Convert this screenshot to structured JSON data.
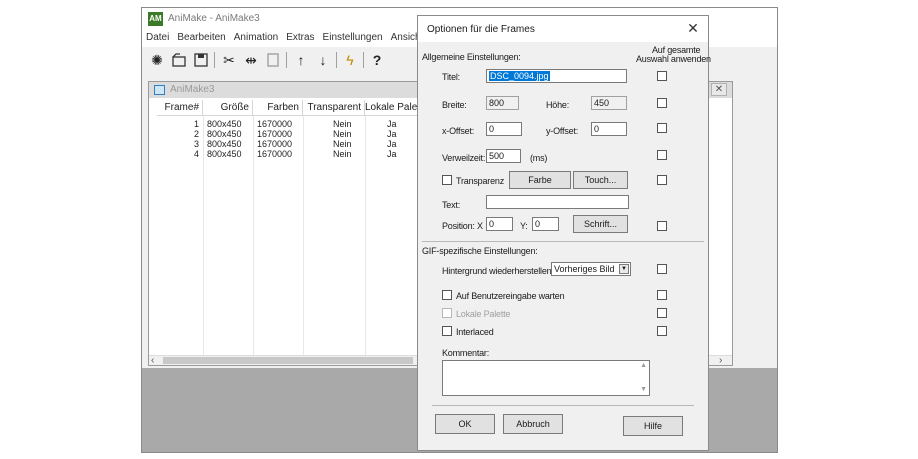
{
  "app": {
    "title": "AniMake - AniMake3",
    "logo": "AM",
    "menu": [
      "Datei",
      "Bearbeiten",
      "Animation",
      "Extras",
      "Einstellungen",
      "Ansicht"
    ],
    "toolbar_icons": [
      "sparkle-icon",
      "open-icon",
      "save-icon",
      "cut-icon",
      "move-icon",
      "paste-icon",
      "arrow-up-icon",
      "arrow-down-icon",
      "lightning-icon",
      "help-icon"
    ]
  },
  "child": {
    "title": "AniMake3",
    "close": "✕",
    "columns": [
      "Frame#",
      "Größe",
      "Farben",
      "Transparent",
      "Lokale Pale..."
    ],
    "rows": [
      [
        "1",
        "800x450",
        "1670000",
        "Nein",
        "Ja"
      ],
      [
        "2",
        "800x450",
        "1670000",
        "Nein",
        "Ja"
      ],
      [
        "3",
        "800x450",
        "1670000",
        "Nein",
        "Ja"
      ],
      [
        "4",
        "800x450",
        "1670000",
        "Nein",
        "Ja"
      ]
    ],
    "scroll_left": "‹",
    "scroll_right": "›"
  },
  "dialog": {
    "title": "Optionen für die Frames",
    "close": "✕",
    "general_header": "Allgemeine Einstellungen:",
    "apply_all_header_1": "Auf gesamte",
    "apply_all_header_2": "Auswahl anwenden",
    "title_label": "Titel:",
    "title_value": "DSC_0094.jpg",
    "width_label": "Breite:",
    "width_value": "800",
    "height_label": "Höhe:",
    "height_value": "450",
    "xoffset_label": "x-Offset:",
    "xoffset_value": "0",
    "yoffset_label": "y-Offset:",
    "yoffset_value": "0",
    "delay_label": "Verweilzeit:",
    "delay_value": "500",
    "delay_unit": "(ms)",
    "transparency_label": "Transparenz",
    "color_button": "Farbe",
    "touch_button": "Touch...",
    "text_label": "Text:",
    "text_value": "",
    "position_x_label": "Position: X",
    "position_x_value": "0",
    "position_y_label": "Y:",
    "position_y_value": "0",
    "font_button": "Schrift...",
    "gif_header": "GIF-spezifische Einstellungen:",
    "bg_restore_label": "Hintergrund wiederherstellen:",
    "bg_restore_value": "Vorheriges Bild",
    "wait_input_label": "Auf Benutzereingabe warten",
    "local_palette_label": "Lokale Palette",
    "interlaced_label": "Interlaced",
    "comment_label": "Kommentar:",
    "comment_value": "",
    "ok_button": "OK",
    "cancel_button": "Abbruch",
    "help_button": "Hilfe"
  }
}
